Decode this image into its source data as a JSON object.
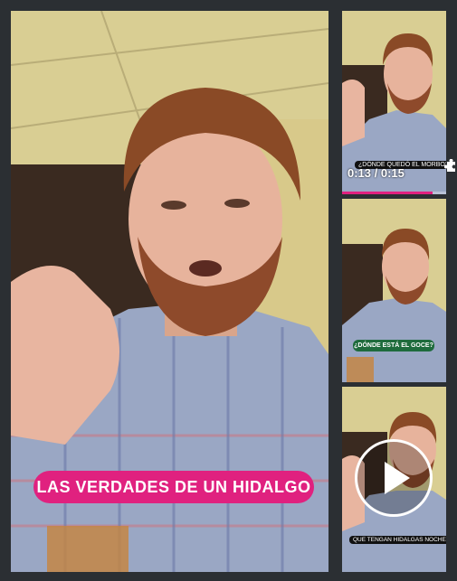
{
  "main_video": {
    "caption": "LAS VERDADES DE UN HIDALGO"
  },
  "thumbs": [
    {
      "caption": "¿DÓNDE QUEDÓ EL MORBO?",
      "timestamp": "0:13 / 0:15"
    },
    {
      "caption": "¿DÓNDE ESTÁ EL GOCE?"
    },
    {
      "caption": "QUE TENGAN HIDALGAS NOCHES"
    }
  ],
  "colors": {
    "accent_pink": "#e0217f",
    "accent_green": "#1e6b3c",
    "background": "#2b2f33"
  },
  "icons": [
    "puzzle-icon",
    "play-icon"
  ]
}
